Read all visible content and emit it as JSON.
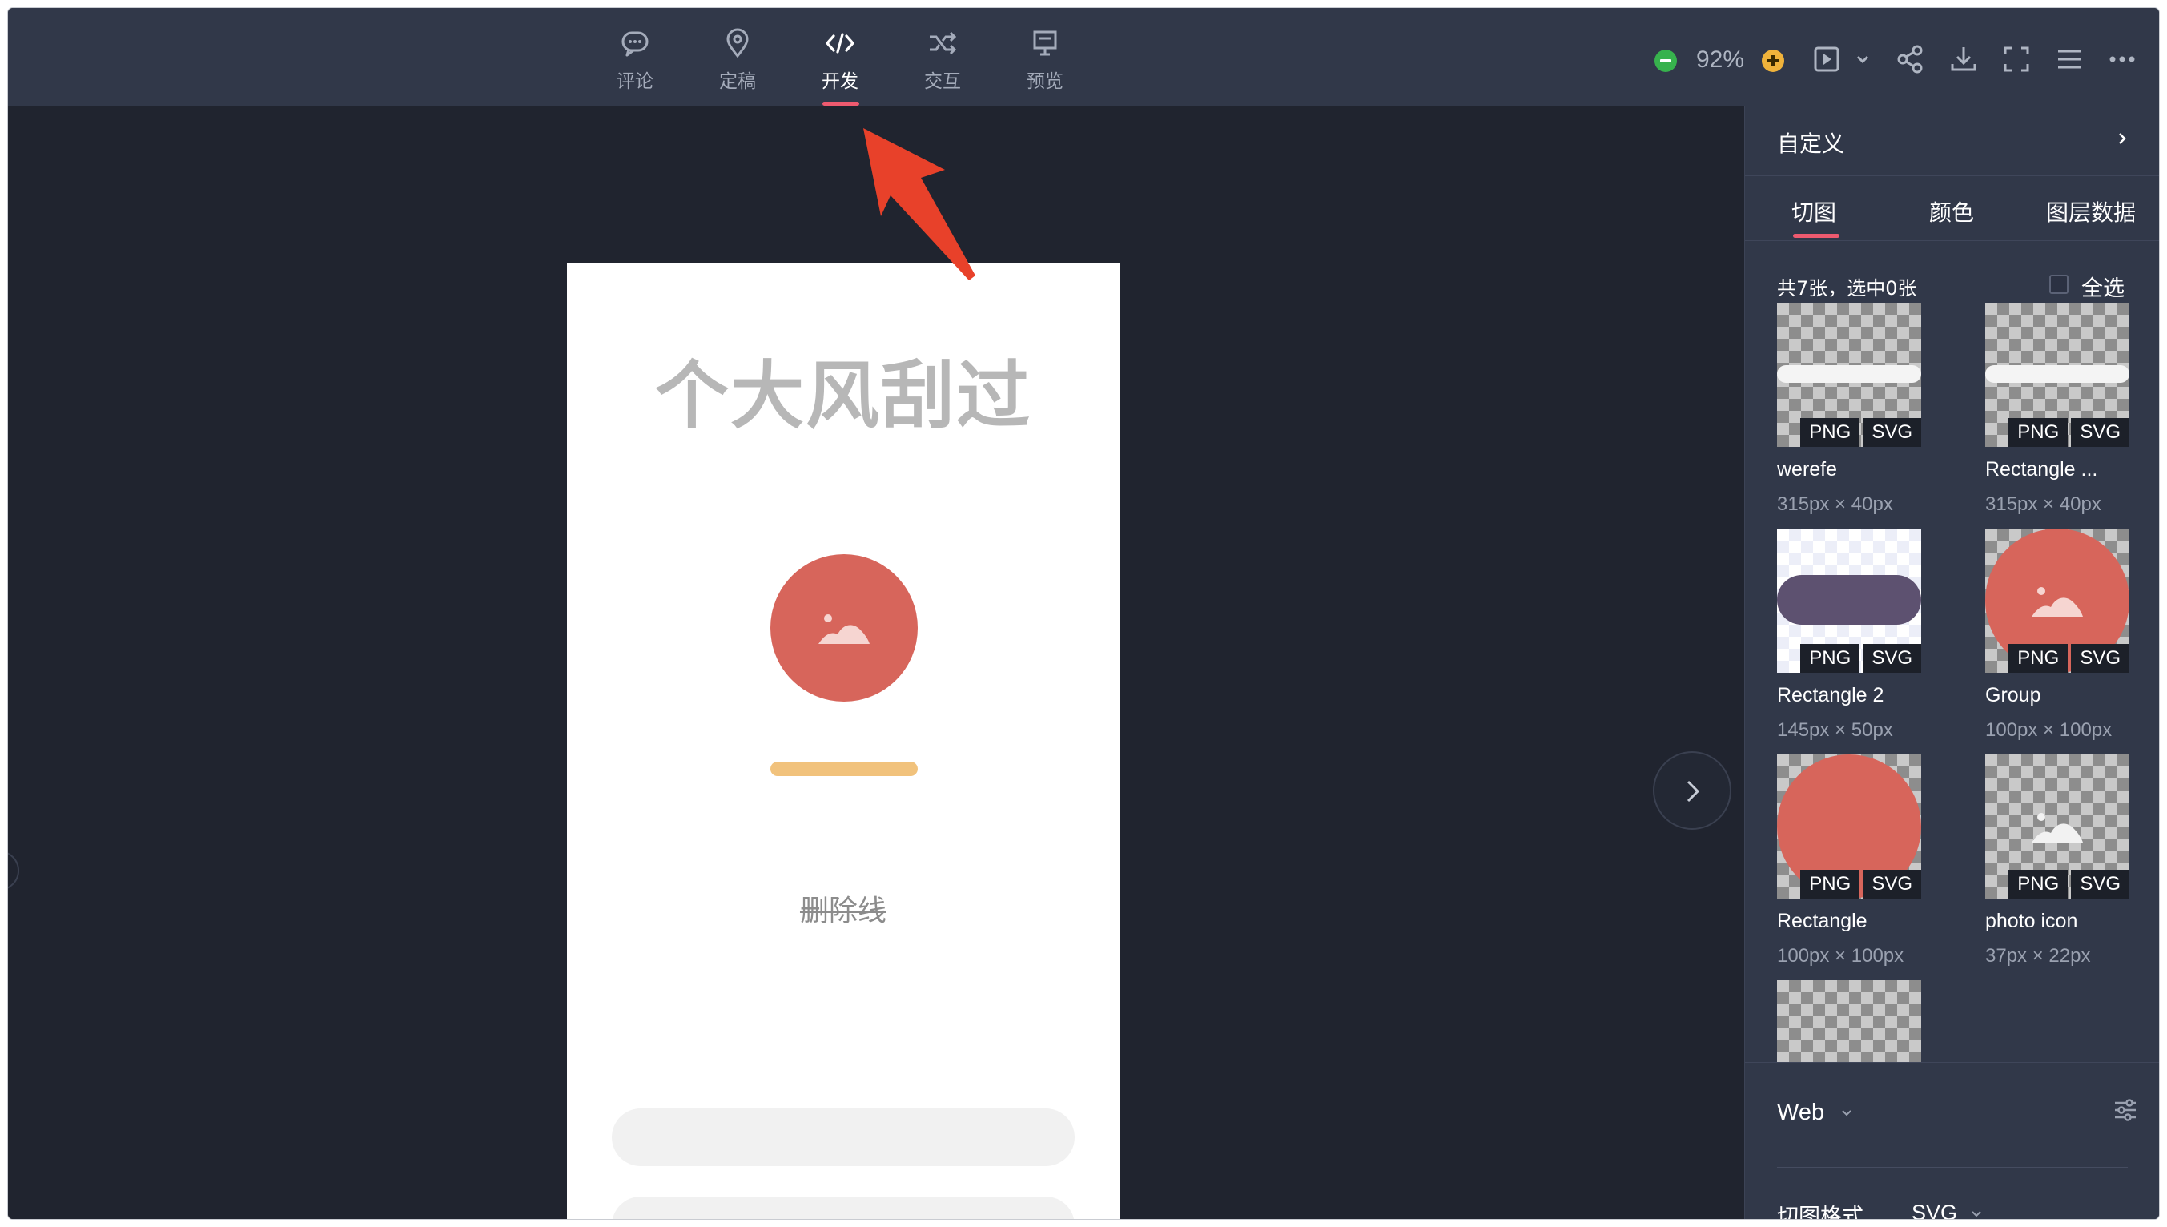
{
  "toolbar": {
    "modes": [
      {
        "label": "评论",
        "icon": "comment-icon"
      },
      {
        "label": "定稿",
        "icon": "pin-icon"
      },
      {
        "label": "开发",
        "icon": "code-icon"
      },
      {
        "label": "交互",
        "icon": "shuffle-icon"
      },
      {
        "label": "预览",
        "icon": "presentation-icon"
      }
    ],
    "active_mode": "开发",
    "zoom": "92%",
    "tools": [
      "play-icon",
      "share-icon",
      "download-icon",
      "fullscreen-icon",
      "menu-icon",
      "more-icon"
    ]
  },
  "canvas": {
    "artboard_title": "个大风刮过",
    "strike_text": "删除线",
    "colors": {
      "circle": "#d7655b",
      "bar": "#f1c27c",
      "annotation_arrow": "#e8412a"
    }
  },
  "panel": {
    "header": "自定义",
    "tabs": [
      "切图",
      "颜色",
      "图层数据"
    ],
    "active_tab": "切图",
    "count_text": "共7张，选中0张",
    "select_all": "全选",
    "badge_png": "PNG",
    "badge_svg": "SVG",
    "slices": [
      {
        "name": "werefe",
        "size": "315px × 40px"
      },
      {
        "name": "Rectangle ...",
        "size": "315px × 40px"
      },
      {
        "name": "Rectangle 2",
        "size": "145px × 50px"
      },
      {
        "name": "Group",
        "size": "100px × 100px"
      },
      {
        "name": "Rectangle",
        "size": "100px × 100px"
      },
      {
        "name": "photo icon",
        "size": "37px × 22px"
      }
    ],
    "platform": "Web",
    "format_label": "切图格式",
    "format_value": "SVG"
  }
}
